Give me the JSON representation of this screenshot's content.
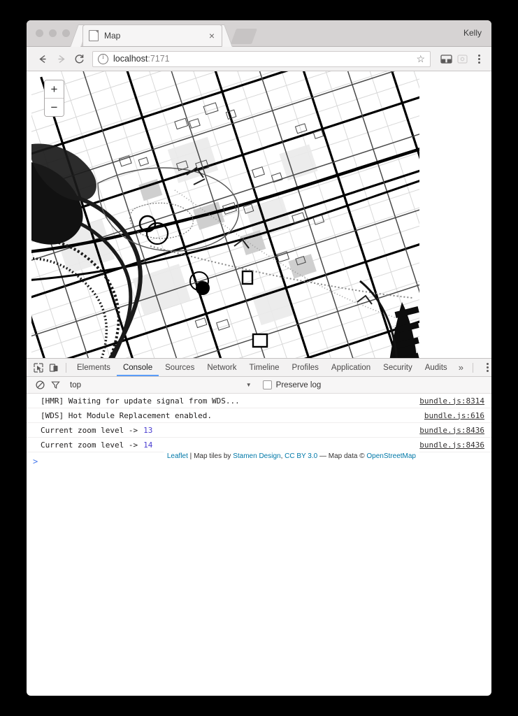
{
  "browser": {
    "profile_name": "Kelly",
    "tab": {
      "title": "Map",
      "favicon": "document-icon",
      "close_label": "×"
    },
    "new_tab_label": "+",
    "nav": {
      "back": "←",
      "forward": "→",
      "reload": "↻"
    },
    "omnibox": {
      "security_icon": "info-icon",
      "host": "localhost",
      "port": ":7171",
      "star_label": "☆"
    },
    "menu_label": "⋮"
  },
  "map": {
    "zoom_in_label": "+",
    "zoom_out_label": "−",
    "attribution": {
      "leaflet": "Leaflet",
      "sep1": " | ",
      "tiles_by": "Map tiles by ",
      "stamen": "Stamen Design",
      "comma": ", ",
      "license": "CC BY 3.0",
      "dash": " — Map data © ",
      "osm": "OpenStreetMap"
    }
  },
  "devtools": {
    "tabs": [
      {
        "label": "Elements",
        "active": false
      },
      {
        "label": "Console",
        "active": true
      },
      {
        "label": "Sources",
        "active": false
      },
      {
        "label": "Network",
        "active": false
      },
      {
        "label": "Timeline",
        "active": false
      },
      {
        "label": "Profiles",
        "active": false
      },
      {
        "label": "Application",
        "active": false
      },
      {
        "label": "Security",
        "active": false
      },
      {
        "label": "Audits",
        "active": false
      }
    ],
    "overflow_label": "»",
    "settings_label": "⋮",
    "close_label": "✕",
    "filterbar": {
      "clear_icon": "clear-console-icon",
      "filter_icon": "filter-icon",
      "context": "top",
      "context_arrow": "▼",
      "preserve_log": "Preserve log"
    },
    "messages": [
      {
        "text": "[HMR] Waiting for update signal from WDS...",
        "value": "",
        "source": "bundle.js:8314"
      },
      {
        "text": "[WDS] Hot Module Replacement enabled.",
        "value": "",
        "source": "bundle.js:616"
      },
      {
        "text": "Current zoom level ->",
        "value": "13",
        "source": "bundle.js:8436"
      },
      {
        "text": "Current zoom level ->",
        "value": "14",
        "source": "bundle.js:8436"
      }
    ],
    "prompt": ">"
  }
}
